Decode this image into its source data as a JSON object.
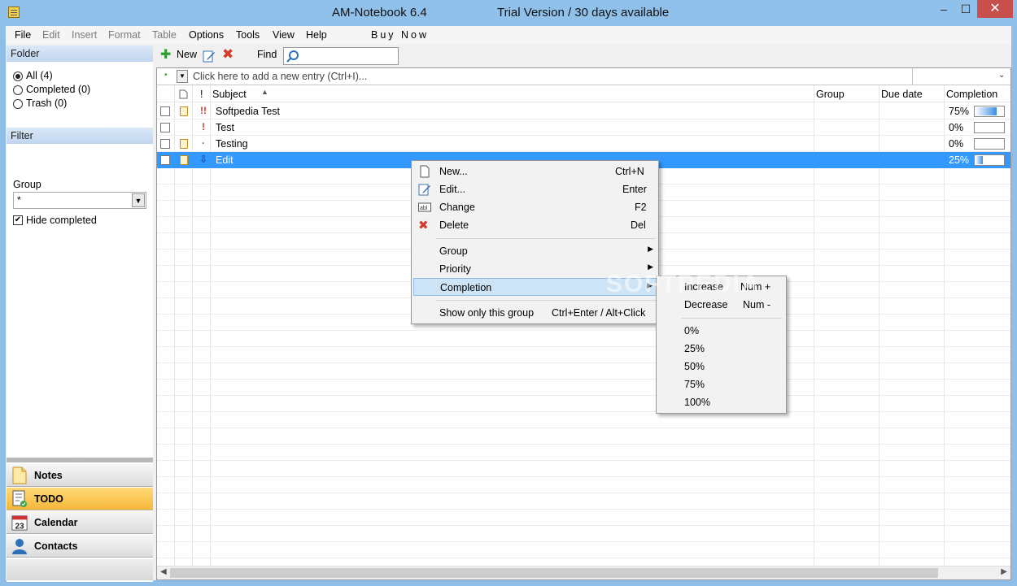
{
  "window": {
    "title": "AM-Notebook  6.4",
    "trial": "Trial Version / 30 days available",
    "minimize_glyph": "–",
    "maximize_glyph": "☐",
    "close_glyph": "✕"
  },
  "menubar": {
    "items": [
      {
        "label": "File",
        "enabled": true
      },
      {
        "label": "Edit",
        "enabled": false
      },
      {
        "label": "Insert",
        "enabled": false
      },
      {
        "label": "Format",
        "enabled": false
      },
      {
        "label": "Table",
        "enabled": false
      },
      {
        "label": "Options",
        "enabled": true
      },
      {
        "label": "Tools",
        "enabled": true
      },
      {
        "label": "View",
        "enabled": true
      },
      {
        "label": "Help",
        "enabled": true
      }
    ],
    "buy_now": "Buy Now"
  },
  "folder": {
    "header": "Folder",
    "items": [
      {
        "label": "All  (4)",
        "selected": true
      },
      {
        "label": "Completed  (0)",
        "selected": false
      },
      {
        "label": "Trash  (0)",
        "selected": false
      }
    ]
  },
  "filter": {
    "header": "Filter",
    "group_label": "Group",
    "group_value": "*",
    "hide_completed_label": "Hide completed",
    "hide_completed_checked": true
  },
  "nav": {
    "items": [
      {
        "label": "Notes",
        "icon": "note-icon",
        "active": false
      },
      {
        "label": "TODO",
        "icon": "todo-icon",
        "active": true
      },
      {
        "label": "Calendar",
        "icon": "calendar-icon",
        "active": false,
        "icon_text": "23"
      },
      {
        "label": "Contacts",
        "icon": "contact-icon",
        "active": false
      }
    ]
  },
  "toolbar": {
    "new_label": "New",
    "find_label": "Find"
  },
  "entry": {
    "placeholder": "Click here to add a new entry (Ctrl+I)..."
  },
  "columns": {
    "priority": "!",
    "subject": "Subject",
    "group": "Group",
    "due": "Due date",
    "completion": "Completion"
  },
  "rows": [
    {
      "subject": "Softpedia Test",
      "priority": "!!",
      "has_note": true,
      "completion": "75%",
      "fraction": 0.75,
      "selected": false
    },
    {
      "subject": "Test",
      "priority": "!",
      "has_note": false,
      "completion": "0%",
      "fraction": 0,
      "selected": false
    },
    {
      "subject": "Testing",
      "priority": "·",
      "has_note": true,
      "completion": "0%",
      "fraction": 0,
      "selected": false
    },
    {
      "subject": "Edit",
      "priority": "⇩",
      "has_note": true,
      "completion": "25%",
      "fraction": 0.25,
      "selected": true
    }
  ],
  "context_menu": {
    "items": [
      {
        "label": "New...",
        "shortcut": "Ctrl+N"
      },
      {
        "label": "Edit...",
        "shortcut": "Enter"
      },
      {
        "label": "Change",
        "shortcut": "F2"
      },
      {
        "label": "Delete",
        "shortcut": "Del"
      },
      {
        "label": "Group",
        "shortcut": ""
      },
      {
        "label": "Priority",
        "shortcut": ""
      },
      {
        "label": "Completion",
        "shortcut": ""
      },
      {
        "label": "Show only this group",
        "shortcut": "Ctrl+Enter / Alt+Click"
      }
    ]
  },
  "completion_submenu": {
    "items": [
      {
        "label": "Increase",
        "shortcut": "Num +"
      },
      {
        "label": "Decrease",
        "shortcut": "Num -"
      },
      {
        "label": "0%",
        "shortcut": ""
      },
      {
        "label": "25%",
        "shortcut": ""
      },
      {
        "label": "50%",
        "shortcut": ""
      },
      {
        "label": "75%",
        "shortcut": ""
      },
      {
        "label": "100%",
        "shortcut": ""
      }
    ]
  },
  "watermark": "SOFTPEDIA",
  "colors": {
    "selection": "#3399ff",
    "titlebar": "#8fc1ea",
    "active_nav": "#f5b83a",
    "delete_red": "#d23a2a",
    "add_green": "#2a9d2a"
  }
}
